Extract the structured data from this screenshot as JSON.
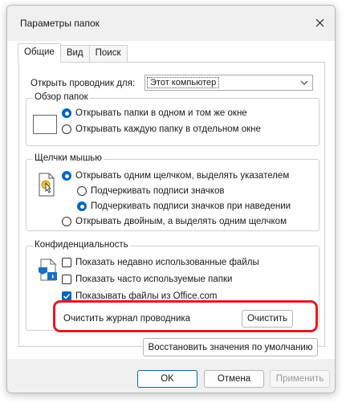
{
  "window": {
    "title": "Параметры папок"
  },
  "tabs": [
    {
      "label": "Общие",
      "active": true
    },
    {
      "label": "Вид",
      "active": false
    },
    {
      "label": "Поиск",
      "active": false
    }
  ],
  "general": {
    "open_explorer_label": "Открыть проводник для:",
    "open_explorer_value": "Этот компьютер",
    "browse": {
      "legend": "Обзор папок",
      "options": [
        {
          "label": "Открывать папки в одном и том же окне",
          "selected": true
        },
        {
          "label": "Открывать каждую папку в отдельном окне",
          "selected": false
        }
      ]
    },
    "clicks": {
      "legend": "Щелчки мышью",
      "single": {
        "label": "Открывать одним щелчком, выделять указателем",
        "selected": true
      },
      "sub": [
        {
          "label": "Подчеркивать подписи значков",
          "selected": false
        },
        {
          "label": "Подчеркивать подписи значков при наведении",
          "selected": true
        }
      ],
      "double": {
        "label": "Открывать двойным, а выделять одним щелчком",
        "selected": false
      }
    },
    "privacy": {
      "legend": "Конфиденциальность",
      "checks": [
        {
          "label": "Показать недавно использованные файлы",
          "checked": false
        },
        {
          "label": "Показать часто используемые папки",
          "checked": false
        },
        {
          "label": "Показывать файлы из Office.com",
          "checked": true
        }
      ],
      "clear_label": "Очистить журнал проводника",
      "clear_button": "Очистить"
    },
    "restore_button": "Восстановить значения по умолчанию"
  },
  "footer": {
    "ok": "OK",
    "cancel": "Отмена",
    "apply": "Применить"
  },
  "colors": {
    "accent": "#0067c0",
    "highlight": "#e11b22"
  }
}
